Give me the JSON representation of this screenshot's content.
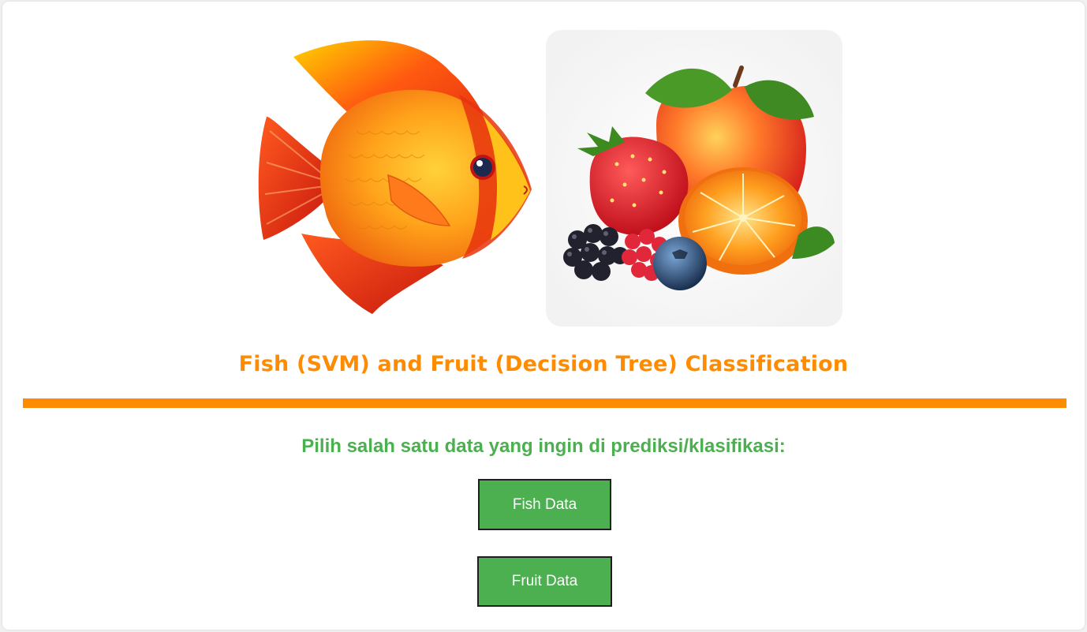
{
  "header": {
    "fish_image": "fish-illustration",
    "fruit_image": "fruit-illustration",
    "title": "Fish (SVM) and Fruit (Decision Tree) Classification"
  },
  "main": {
    "prompt": "Pilih salah satu data yang ingin di prediksi/klasifikasi:",
    "buttons": [
      {
        "label": "Fish Data"
      },
      {
        "label": "Fruit Data"
      }
    ]
  },
  "colors": {
    "accent": "#ff8c00",
    "primary": "#4caf50",
    "button_text": "#ffffff"
  }
}
